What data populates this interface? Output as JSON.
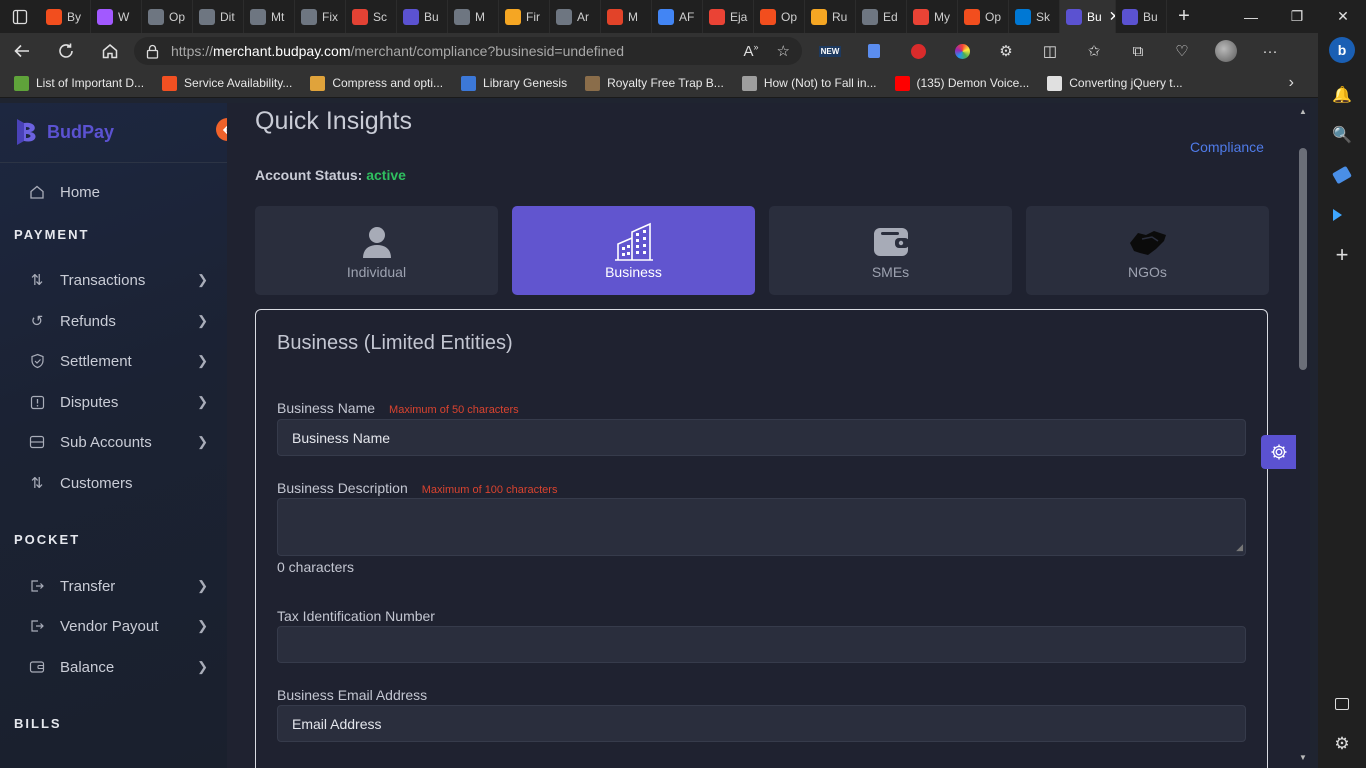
{
  "browser": {
    "tabs": [
      {
        "label": "By",
        "color": "#f24e1e"
      },
      {
        "label": "W",
        "color": "#a259ff"
      },
      {
        "label": "Op",
        "color": "#6e7681"
      },
      {
        "label": "Dit",
        "color": "#6e7681"
      },
      {
        "label": "Mt",
        "color": "#6e7681"
      },
      {
        "label": "Fix",
        "color": "#6e7681"
      },
      {
        "label": "Sc",
        "color": "#e34234"
      },
      {
        "label": "Bu",
        "color": "#5b52d1"
      },
      {
        "label": "M",
        "color": "#6e7681"
      },
      {
        "label": "Fir",
        "color": "#f5a623"
      },
      {
        "label": "Ar",
        "color": "#6e7681"
      },
      {
        "label": "M",
        "color": "#e24329"
      },
      {
        "label": "AF",
        "color": "#4285f4"
      },
      {
        "label": "Eja",
        "color": "#ea4335"
      },
      {
        "label": "Op",
        "color": "#f24e1e"
      },
      {
        "label": "Ru",
        "color": "#f5a623"
      },
      {
        "label": "Ed",
        "color": "#6e7681"
      },
      {
        "label": "My",
        "color": "#ea4335"
      },
      {
        "label": "Op",
        "color": "#f24e1e"
      },
      {
        "label": "Sk",
        "color": "#0078d4"
      }
    ],
    "active_tab": {
      "label": "Bu",
      "color": "#5b52d1"
    },
    "last_tab": {
      "label": "Bu",
      "color": "#5b52d1"
    },
    "url_scheme": "https://",
    "url_host": "merchant.budpay.com",
    "url_path": "/merchant/compliance?businesid=undefined",
    "bookmarks": [
      {
        "label": "List of Important D...",
        "color": "#5fa33a"
      },
      {
        "label": "Service Availability...",
        "color": "#f25022"
      },
      {
        "label": "Compress and opti...",
        "color": "#e0a33b"
      },
      {
        "label": "Library Genesis",
        "color": "#3c78d8"
      },
      {
        "label": "Royalty Free Trap B...",
        "color": "#8a6d4a"
      },
      {
        "label": "How (Not) to Fall in...",
        "color": "#9e9e9e"
      },
      {
        "label": "(135) Demon Voice...",
        "color": "#ff0000"
      },
      {
        "label": "Converting jQuery t...",
        "color": "#e0e0e0"
      }
    ]
  },
  "app": {
    "brand": "BudPay",
    "nav": {
      "home": "Home",
      "payment_section": "PAYMENT",
      "transactions": "Transactions",
      "refunds": "Refunds",
      "settlement": "Settlement",
      "disputes": "Disputes",
      "sub_accounts": "Sub Accounts",
      "customers": "Customers",
      "pocket_section": "POCKET",
      "transfer": "Transfer",
      "vendor_payout": "Vendor Payout",
      "balance": "Balance",
      "bills_section": "BILLS"
    },
    "page_title": "Quick Insights",
    "breadcrumb": "Compliance",
    "account_status_label": "Account Status:",
    "account_status_value": "active",
    "account_types": [
      {
        "label": "Individual",
        "icon": "person-icon"
      },
      {
        "label": "Business",
        "icon": "building-icon"
      },
      {
        "label": "SMEs",
        "icon": "wallet-icon"
      },
      {
        "label": "NGOs",
        "icon": "handshake-icon"
      }
    ],
    "selected_type": "Business",
    "form": {
      "title": "Business (Limited Entities)",
      "business_name_label": "Business Name",
      "business_name_hint": "Maximum of 50 characters",
      "business_name_placeholder": "Business Name",
      "description_label": "Business Description",
      "description_hint": "Maximum of 100 characters",
      "description_count": "0 characters",
      "tin_label": "Tax Identification Number",
      "email_label": "Business Email Address",
      "email_placeholder": "Email Address"
    },
    "colors": {
      "brand": "#5b52d1",
      "active_status": "#2fbf5f",
      "hint": "#d9432f",
      "link": "#4f7be8",
      "collapse_button": "#f0622a"
    }
  }
}
